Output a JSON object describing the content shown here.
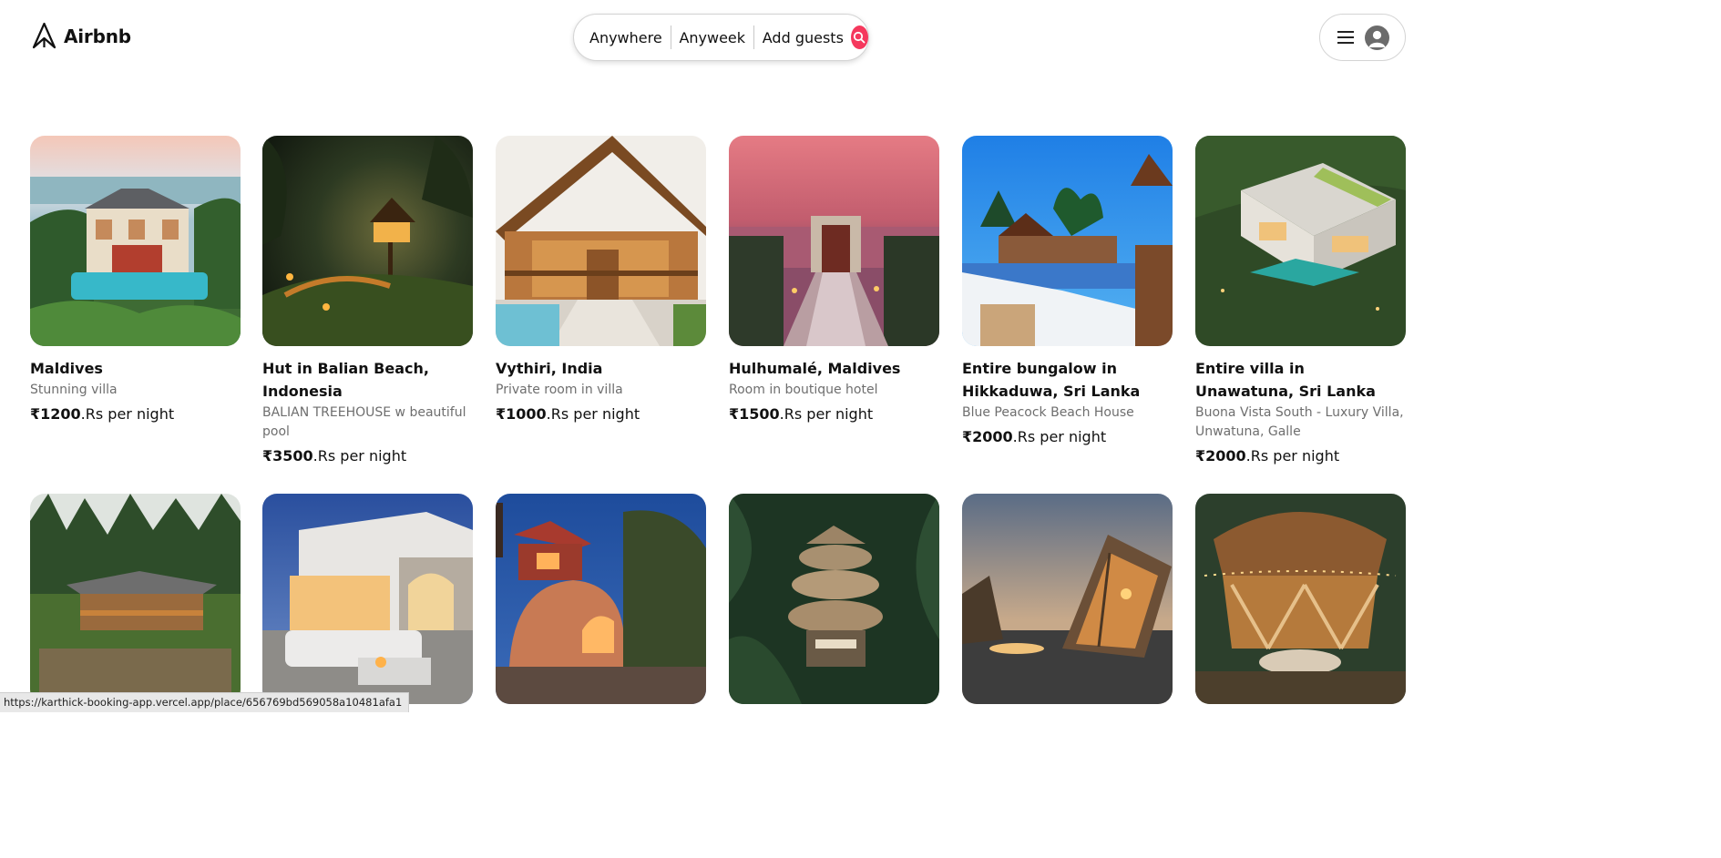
{
  "header": {
    "logo_text": "Airbnb",
    "search": {
      "where": "Anywhere",
      "when": "Anyweek",
      "guests": "Add guests"
    },
    "accent_color": "#f5385d"
  },
  "listings": [
    {
      "title": "Maldives",
      "subtitle": "Stunning villa",
      "price": "₹1200",
      "price_suffix": ".Rs per night",
      "image": "beach-villa-pool"
    },
    {
      "title": "Hut in Balian Beach, Indonesia",
      "subtitle": "BALIAN TREEHOUSE w beautiful pool",
      "price": "₹3500",
      "price_suffix": ".Rs per night",
      "image": "treehouse-night"
    },
    {
      "title": "Vythiri, India",
      "subtitle": "Private room in villa",
      "price": "₹1000",
      "price_suffix": ".Rs per night",
      "image": "wooden-cottage"
    },
    {
      "title": "Hulhumalé, Maldives",
      "subtitle": "Room in boutique hotel",
      "price": "₹1500",
      "price_suffix": ".Rs per night",
      "image": "sunset-sea-gate"
    },
    {
      "title": "Entire bungalow in Hikkaduwa, Sri Lanka",
      "subtitle": "Blue Peacock Beach House",
      "price": "₹2000",
      "price_suffix": ".Rs per night",
      "image": "pool-bungalow-palms"
    },
    {
      "title": "Entire villa in Unawatuna, Sri Lanka",
      "subtitle": "Buona Vista South - Luxury Villa, Unwatuna, Galle",
      "price": "₹2000",
      "price_suffix": ".Rs per night",
      "image": "aerial-villa"
    },
    {
      "image": "mountain-house-forest"
    },
    {
      "image": "white-villa-lounge"
    },
    {
      "image": "dome-house-dusk"
    },
    {
      "image": "jungle-hut-tower"
    },
    {
      "image": "a-frame-cabins"
    },
    {
      "image": "bamboo-pavilion"
    }
  ],
  "status_url": "https://karthick-booking-app.vercel.app/place/656769bd569058a10481afa1"
}
